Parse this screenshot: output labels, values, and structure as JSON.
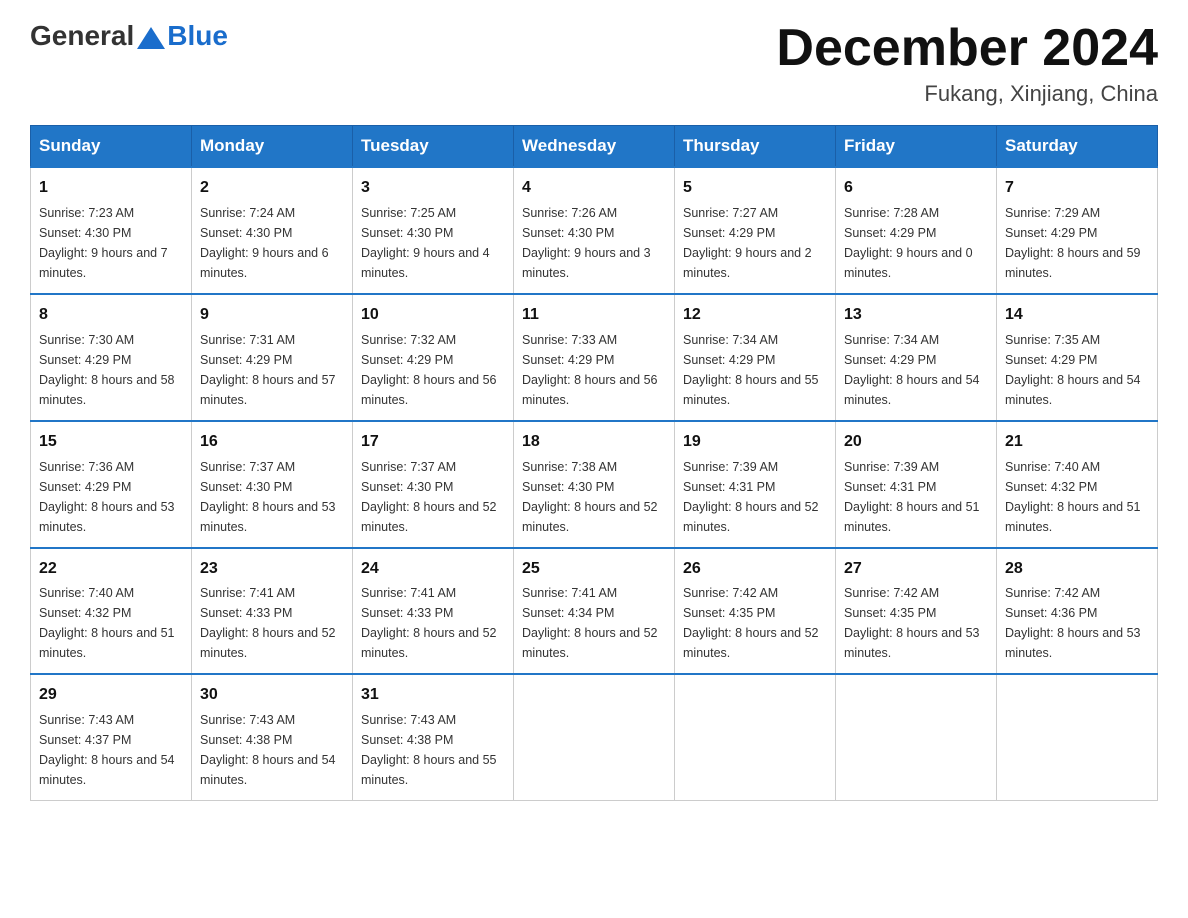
{
  "header": {
    "logo_general": "General",
    "logo_blue": "Blue",
    "month_title": "December 2024",
    "location": "Fukang, Xinjiang, China"
  },
  "calendar": {
    "days_of_week": [
      "Sunday",
      "Monday",
      "Tuesday",
      "Wednesday",
      "Thursday",
      "Friday",
      "Saturday"
    ],
    "weeks": [
      [
        {
          "day": "1",
          "sunrise": "7:23 AM",
          "sunset": "4:30 PM",
          "daylight": "9 hours and 7 minutes."
        },
        {
          "day": "2",
          "sunrise": "7:24 AM",
          "sunset": "4:30 PM",
          "daylight": "9 hours and 6 minutes."
        },
        {
          "day": "3",
          "sunrise": "7:25 AM",
          "sunset": "4:30 PM",
          "daylight": "9 hours and 4 minutes."
        },
        {
          "day": "4",
          "sunrise": "7:26 AM",
          "sunset": "4:30 PM",
          "daylight": "9 hours and 3 minutes."
        },
        {
          "day": "5",
          "sunrise": "7:27 AM",
          "sunset": "4:29 PM",
          "daylight": "9 hours and 2 minutes."
        },
        {
          "day": "6",
          "sunrise": "7:28 AM",
          "sunset": "4:29 PM",
          "daylight": "9 hours and 0 minutes."
        },
        {
          "day": "7",
          "sunrise": "7:29 AM",
          "sunset": "4:29 PM",
          "daylight": "8 hours and 59 minutes."
        }
      ],
      [
        {
          "day": "8",
          "sunrise": "7:30 AM",
          "sunset": "4:29 PM",
          "daylight": "8 hours and 58 minutes."
        },
        {
          "day": "9",
          "sunrise": "7:31 AM",
          "sunset": "4:29 PM",
          "daylight": "8 hours and 57 minutes."
        },
        {
          "day": "10",
          "sunrise": "7:32 AM",
          "sunset": "4:29 PM",
          "daylight": "8 hours and 56 minutes."
        },
        {
          "day": "11",
          "sunrise": "7:33 AM",
          "sunset": "4:29 PM",
          "daylight": "8 hours and 56 minutes."
        },
        {
          "day": "12",
          "sunrise": "7:34 AM",
          "sunset": "4:29 PM",
          "daylight": "8 hours and 55 minutes."
        },
        {
          "day": "13",
          "sunrise": "7:34 AM",
          "sunset": "4:29 PM",
          "daylight": "8 hours and 54 minutes."
        },
        {
          "day": "14",
          "sunrise": "7:35 AM",
          "sunset": "4:29 PM",
          "daylight": "8 hours and 54 minutes."
        }
      ],
      [
        {
          "day": "15",
          "sunrise": "7:36 AM",
          "sunset": "4:29 PM",
          "daylight": "8 hours and 53 minutes."
        },
        {
          "day": "16",
          "sunrise": "7:37 AM",
          "sunset": "4:30 PM",
          "daylight": "8 hours and 53 minutes."
        },
        {
          "day": "17",
          "sunrise": "7:37 AM",
          "sunset": "4:30 PM",
          "daylight": "8 hours and 52 minutes."
        },
        {
          "day": "18",
          "sunrise": "7:38 AM",
          "sunset": "4:30 PM",
          "daylight": "8 hours and 52 minutes."
        },
        {
          "day": "19",
          "sunrise": "7:39 AM",
          "sunset": "4:31 PM",
          "daylight": "8 hours and 52 minutes."
        },
        {
          "day": "20",
          "sunrise": "7:39 AM",
          "sunset": "4:31 PM",
          "daylight": "8 hours and 51 minutes."
        },
        {
          "day": "21",
          "sunrise": "7:40 AM",
          "sunset": "4:32 PM",
          "daylight": "8 hours and 51 minutes."
        }
      ],
      [
        {
          "day": "22",
          "sunrise": "7:40 AM",
          "sunset": "4:32 PM",
          "daylight": "8 hours and 51 minutes."
        },
        {
          "day": "23",
          "sunrise": "7:41 AM",
          "sunset": "4:33 PM",
          "daylight": "8 hours and 52 minutes."
        },
        {
          "day": "24",
          "sunrise": "7:41 AM",
          "sunset": "4:33 PM",
          "daylight": "8 hours and 52 minutes."
        },
        {
          "day": "25",
          "sunrise": "7:41 AM",
          "sunset": "4:34 PM",
          "daylight": "8 hours and 52 minutes."
        },
        {
          "day": "26",
          "sunrise": "7:42 AM",
          "sunset": "4:35 PM",
          "daylight": "8 hours and 52 minutes."
        },
        {
          "day": "27",
          "sunrise": "7:42 AM",
          "sunset": "4:35 PM",
          "daylight": "8 hours and 53 minutes."
        },
        {
          "day": "28",
          "sunrise": "7:42 AM",
          "sunset": "4:36 PM",
          "daylight": "8 hours and 53 minutes."
        }
      ],
      [
        {
          "day": "29",
          "sunrise": "7:43 AM",
          "sunset": "4:37 PM",
          "daylight": "8 hours and 54 minutes."
        },
        {
          "day": "30",
          "sunrise": "7:43 AM",
          "sunset": "4:38 PM",
          "daylight": "8 hours and 54 minutes."
        },
        {
          "day": "31",
          "sunrise": "7:43 AM",
          "sunset": "4:38 PM",
          "daylight": "8 hours and 55 minutes."
        },
        null,
        null,
        null,
        null
      ]
    ]
  }
}
